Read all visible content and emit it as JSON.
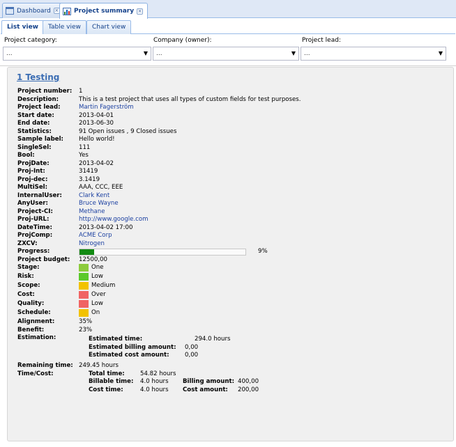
{
  "doc_tabs": [
    {
      "label": "Dashboard",
      "close": "×"
    },
    {
      "label": "Project summary",
      "close": "×"
    }
  ],
  "view_tabs": [
    "List view",
    "Table view",
    "Chart view"
  ],
  "filters": {
    "category": {
      "label": "Project category:",
      "value": "..."
    },
    "company": {
      "label": "Company (owner):",
      "value": "..."
    },
    "lead": {
      "label": "Project lead:",
      "value": "..."
    }
  },
  "project": {
    "title": "1  Testing",
    "fields": [
      {
        "label": "Project number:",
        "value": "1"
      },
      {
        "label": "Description:",
        "value": "This is a test project that uses all types of custom fields for test purposes."
      },
      {
        "label": "Project lead:",
        "value": "Martin Fagerström",
        "link": true
      },
      {
        "label": "Start date:",
        "value": "2013-04-01"
      },
      {
        "label": "End date:",
        "value": "2013-06-30"
      },
      {
        "label": "Statistics:",
        "value": "91 Open issues , 9 Closed issues"
      },
      {
        "label": "Sample label:",
        "value": "Hello world!"
      },
      {
        "label": "SingleSel:",
        "value": "111"
      },
      {
        "label": "Bool:",
        "value": "Yes"
      },
      {
        "label": "ProjDate:",
        "value": "2013-04-02"
      },
      {
        "label": "Proj-Int:",
        "value": "31419"
      },
      {
        "label": "Proj-dec:",
        "value": "3.1419"
      },
      {
        "label": "MultiSel:",
        "value": "AAA, CCC, EEE"
      },
      {
        "label": "InternalUser:",
        "value": "Clark Kent",
        "link": true
      },
      {
        "label": "AnyUser:",
        "value": "Bruce Wayne",
        "link": true
      },
      {
        "label": "Project-CI:",
        "value": "Methane",
        "link": true
      },
      {
        "label": "Proj-URL:",
        "value": "http://www.google.com",
        "link": true
      },
      {
        "label": "DateTime:",
        "value": "2013-04-02 17:00"
      },
      {
        "label": "ProjComp:",
        "value": "ACME Corp",
        "link": true
      },
      {
        "label": "ZXCV:",
        "value": "Nitrogen",
        "link": true
      }
    ],
    "progress": {
      "label": "Progress:",
      "value": 0.09,
      "text": "9%"
    },
    "budget": {
      "label": "Project budget:",
      "value": "12500,00"
    },
    "status_fields": [
      {
        "label": "Stage:",
        "value": "One",
        "color": "#8ccb3c"
      },
      {
        "label": "Risk:",
        "value": "Low",
        "color": "#5bc92b"
      },
      {
        "label": "Scope:",
        "value": "Medium",
        "color": "#f2c200"
      },
      {
        "label": "Cost:",
        "value": "Over",
        "color": "#f06464"
      },
      {
        "label": "Quality:",
        "value": "Low",
        "color": "#f06464"
      },
      {
        "label": "Schedule:",
        "value": "On",
        "color": "#f2c200"
      }
    ],
    "alignment": {
      "label": "Alignment:",
      "value": "35%"
    },
    "benefit": {
      "label": "Benefit:",
      "value": "23%"
    },
    "estimation": {
      "label": "Estimation:",
      "time_label": "Estimated time:",
      "time_value": "294.0 hours",
      "billing_label": "Estimated billing amount:",
      "billing_value": "0,00",
      "cost_label": "Estimated cost amount:",
      "cost_value": "0,00"
    },
    "remaining": {
      "label": "Remaining time:",
      "value": "249.45 hours"
    },
    "timecost": {
      "label": "Time/Cost:",
      "total_label": "Total time:",
      "total_value": "54.82 hours",
      "billable_label": "Billable time:",
      "billable_value": "4.0 hours",
      "billing_amount_label": "Billing amount:",
      "billing_amount_value": "400,00",
      "cost_time_label": "Cost time:",
      "cost_time_value": "4.0 hours",
      "cost_amount_label": "Cost amount:",
      "cost_amount_value": "200,00"
    }
  }
}
